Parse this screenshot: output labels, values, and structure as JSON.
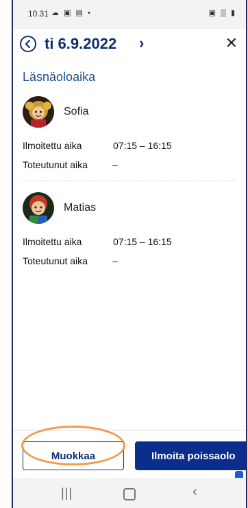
{
  "status_bar": {
    "time": "10.31",
    "left_icons": "☁ ▣ ▤ •",
    "right_icons": "▣ ▒ ▮"
  },
  "header": {
    "date": "ti 6.9.2022",
    "next_symbol": "›",
    "close_symbol": "✕"
  },
  "section_title": "Läsnäoloaika",
  "children": [
    {
      "name": "Sofia",
      "reported_label": "Ilmoitettu aika",
      "reported_value": "07:15 – 16:15",
      "actual_label": "Toteutunut aika",
      "actual_value": "–"
    },
    {
      "name": "Matias",
      "reported_label": "Ilmoitettu aika",
      "reported_value": "07:15 – 16:15",
      "actual_label": "Toteutunut aika",
      "actual_value": "–"
    }
  ],
  "footer": {
    "edit_label": "Muokkaa",
    "absence_label": "Ilmoita poissaolo"
  },
  "nav": {
    "recent": "|||",
    "back": "‹"
  },
  "colors": {
    "primary": "#0b2d8c",
    "title": "#0e2f6f",
    "section": "#1d4e8f",
    "highlight": "#f29a4a"
  }
}
